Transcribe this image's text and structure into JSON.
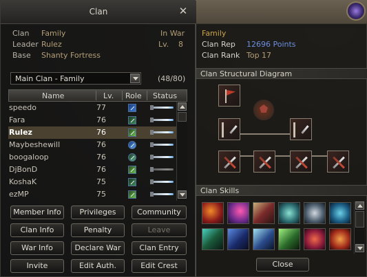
{
  "window_title": "Clan",
  "clan_info": {
    "clan_label": "Clan",
    "clan_value": "Family",
    "leader_label": "Leader",
    "leader_value": "Rulez",
    "base_label": "Base",
    "base_value": "Shanty Fortress",
    "war_status": "In War",
    "lv_label": "Lv.",
    "lv_value": "8"
  },
  "clan_select": {
    "selected": "Main Clan - Family",
    "count": "(48/80)"
  },
  "table": {
    "headers": {
      "name": "Name",
      "lv": "Lv.",
      "role": "Role",
      "status": "Status"
    },
    "rows": [
      {
        "name": "speedo",
        "lv": "77"
      },
      {
        "name": "Fara",
        "lv": "76"
      },
      {
        "name": "Rulez",
        "lv": "76",
        "selected": true
      },
      {
        "name": "Maybeshewill",
        "lv": "76"
      },
      {
        "name": "boogaloop",
        "lv": "76"
      },
      {
        "name": "DjBonD",
        "lv": "76",
        "offline": true
      },
      {
        "name": "KoshaK",
        "lv": "75"
      },
      {
        "name": "ezMP",
        "lv": "75"
      }
    ]
  },
  "buttons": {
    "member_info": "Member Info",
    "privileges": "Privileges",
    "community": "Community",
    "clan_info": "Clan Info",
    "penalty": "Penalty",
    "leave": "Leave",
    "war_info": "War Info",
    "declare_war": "Declare War",
    "clan_entry": "Clan Entry",
    "invite": "Invite",
    "edit_auth": "Edit Auth.",
    "edit_crest": "Edit Crest"
  },
  "right_panel": {
    "family_name": "Family",
    "clan_rep_label": "Clan Rep",
    "clan_rep_value": "12696 Points",
    "clan_rank_label": "Clan Rank",
    "clan_rank_value": "Top 17",
    "structural_diagram_title": "Clan Structural Diagram",
    "clan_skills_title": "Clan Skills",
    "close_label": "Close"
  },
  "colors": {
    "accent_gold": "#b59f78",
    "rep_blue": "#6d8fe0",
    "family_gold": "#c8a64a"
  }
}
